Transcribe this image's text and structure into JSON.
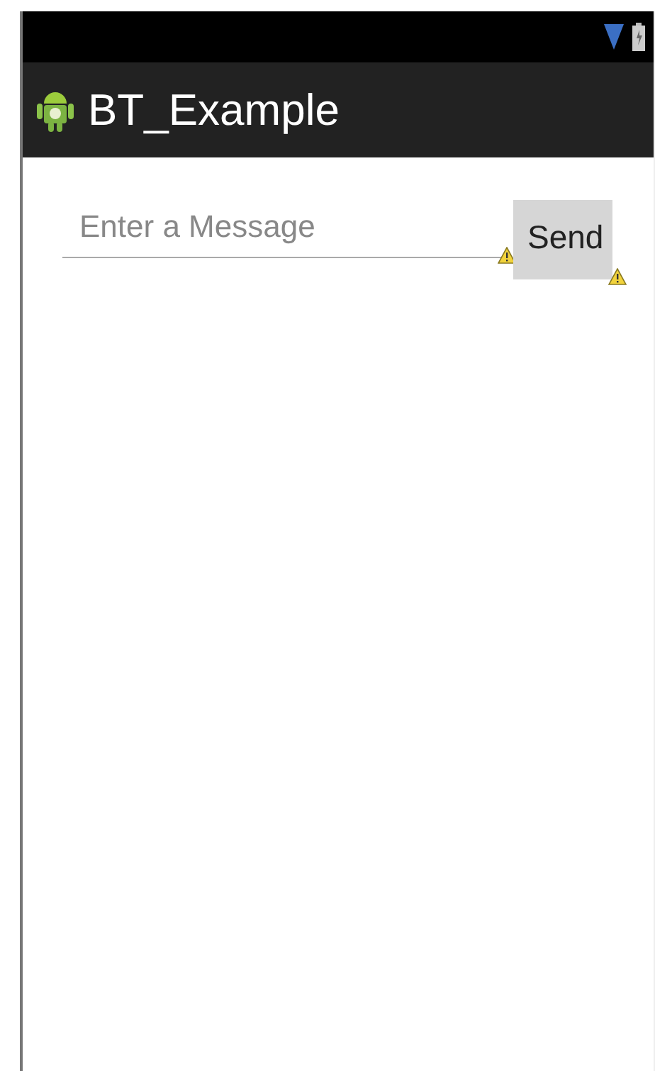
{
  "app_bar": {
    "title": "BT_Example"
  },
  "message_field": {
    "placeholder": "Enter a Message"
  },
  "send_button": {
    "label": "Send"
  }
}
